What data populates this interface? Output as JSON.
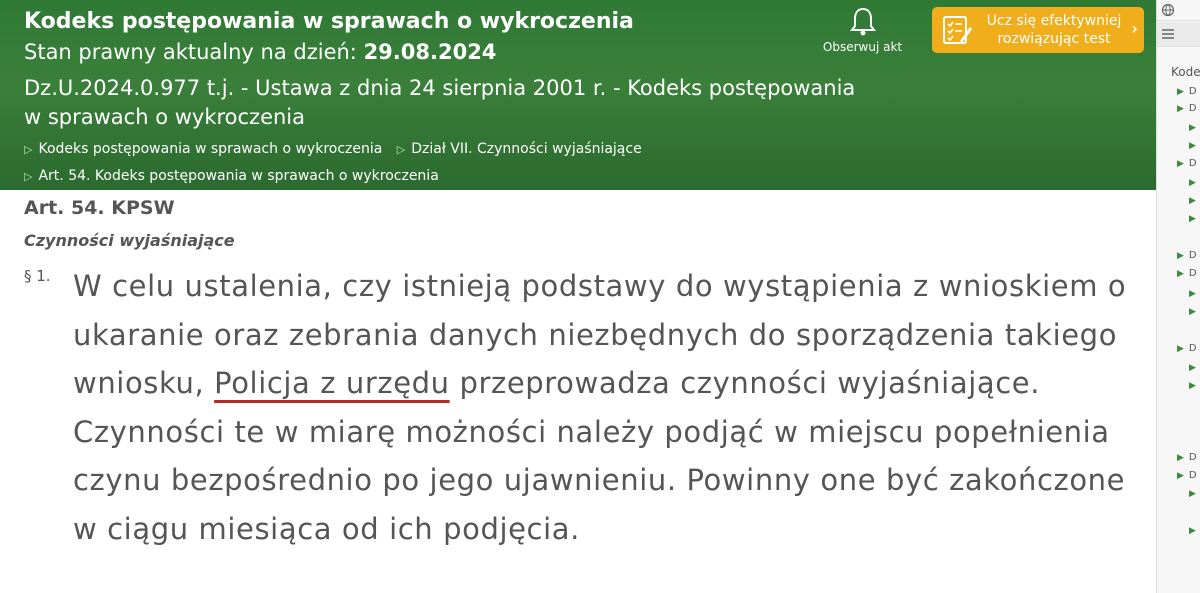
{
  "header": {
    "title": "Kodeks postępowania w sprawach o wykroczenia",
    "state_label": "Stan prawny aktualny na dzień:",
    "state_date": "29.08.2024",
    "dz_line1": "Dz.U.2024.0.977 t.j. - Ustawa z dnia 24 sierpnia 2001 r. - Kodeks postępowania",
    "dz_line2": "w sprawach o wykroczenia",
    "breadcrumbs": [
      "Kodeks postępowania w sprawach o wykroczenia",
      "Dział VII. Czynności wyjaśniające",
      "Art. 54. Kodeks postępowania w sprawach o wykroczenia"
    ],
    "observe_label": "Obserwuj akt",
    "cta_line1": "Ucz się efektywniej",
    "cta_line2": "rozwiązując test"
  },
  "article": {
    "title": "Art. 54. KPSW",
    "subtitle": "Czynności wyjaśniające",
    "paragraph_number": "§ 1.",
    "text_before": "W celu ustalenia, czy istnieją podstawy do wystąpienia z wnioskiem o ukaranie oraz zebrania danych niezbędnych do sporządzenia takiego wniosku,",
    "text_highlight": "Policja z urzędu",
    "text_after": "przeprowadza czynności wyjaśniające. Czynności te w miarę możności należy podjąć w miejscu popełnienia czynu bezpośrednio po jego ujawnieniu. Powinny one być zakończone w ciągu miesiąca od ich podjęcia."
  },
  "sidebar": {
    "label": "Kode",
    "items": [
      "D",
      "D",
      "",
      "",
      "D",
      "",
      "",
      "",
      "D",
      "D",
      "",
      "",
      "D",
      "",
      "",
      "D",
      "D",
      "",
      ""
    ]
  },
  "colors": {
    "header_green": "#3a7f3a",
    "cta_orange": "#f0ae1c",
    "highlight_underline": "#b52a22"
  }
}
